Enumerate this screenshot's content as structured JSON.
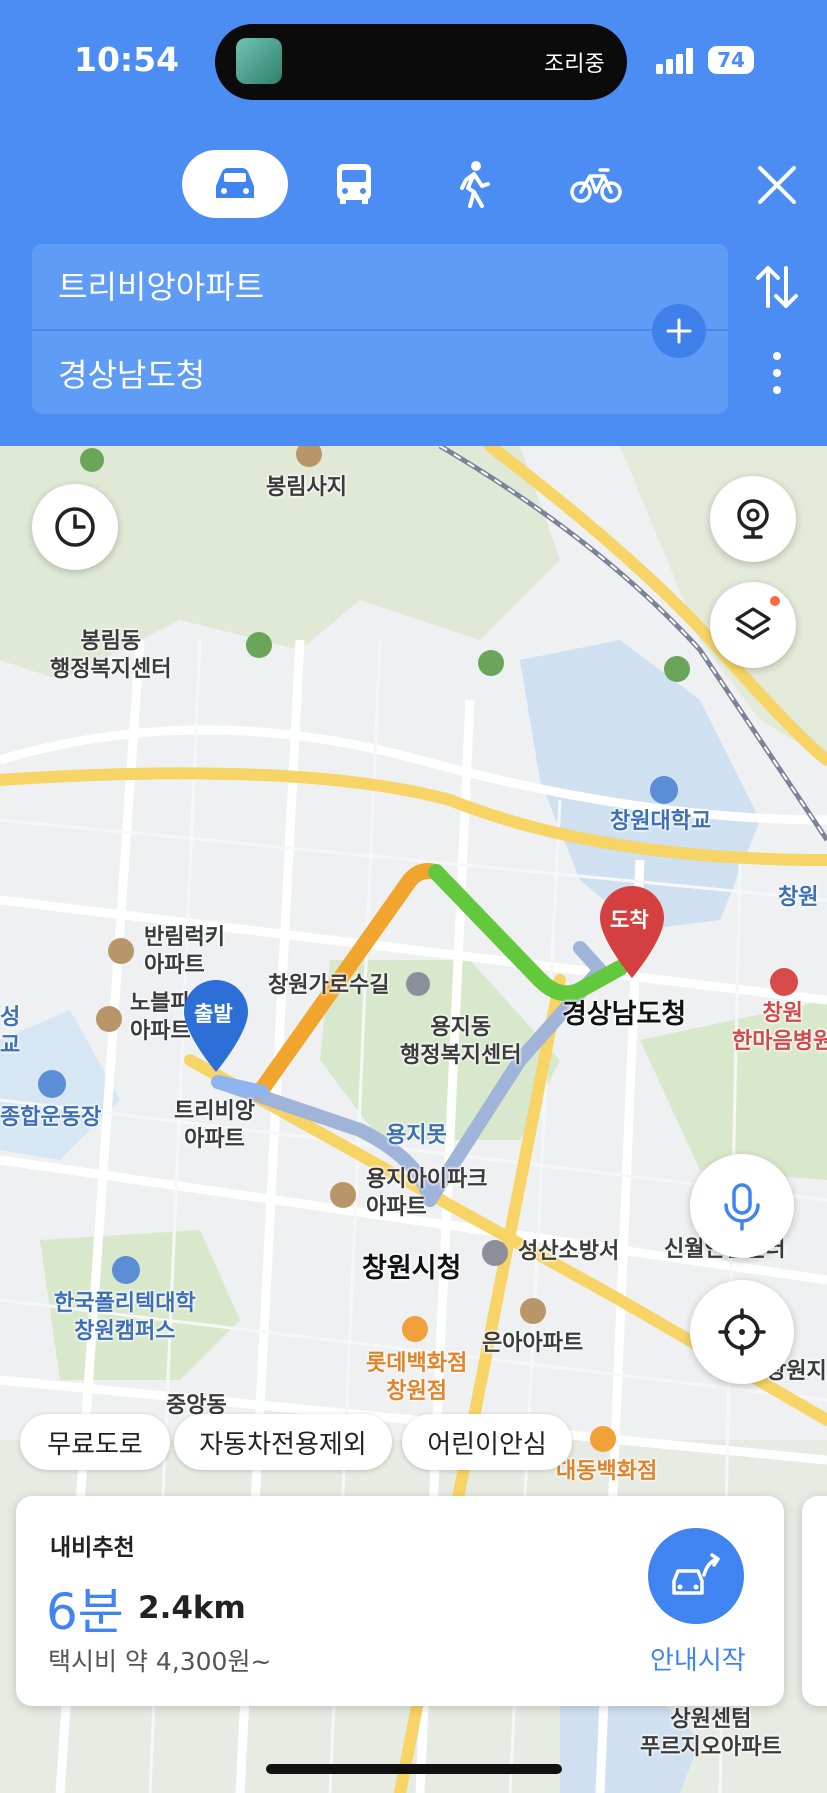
{
  "status_bar": {
    "time": "10:54",
    "activity": "조리중",
    "battery": "74"
  },
  "transport_modes": [
    {
      "id": "car",
      "icon": "car-icon",
      "selected": true
    },
    {
      "id": "bus",
      "icon": "bus-icon",
      "selected": false
    },
    {
      "id": "walk",
      "icon": "walk-icon",
      "selected": false
    },
    {
      "id": "bike",
      "icon": "bike-icon",
      "selected": false
    }
  ],
  "route": {
    "origin": "트리비앙아파트",
    "destination": "경상남도청"
  },
  "map": {
    "origin_pin": "출발",
    "destination_pin": "도착",
    "labels": {
      "bongrimsaji": "봉림사지",
      "bongrim_center": "봉림동\n행정복지센터",
      "university": "창원대학교",
      "changwon_edge": "창원",
      "banrim": "반림럭키\n아파트",
      "nobelpark": "노블파크\n아파트",
      "garosu": "창원가로수길",
      "yongji_center": "용지동\n행정복지센터",
      "gyeongnam": "경상남도청",
      "hospital": "창원\n한마음병원",
      "stadium": "종합운동장",
      "left_edge": "성\n교",
      "trivian": "트리비앙\n아파트",
      "yongjimot": "용지못",
      "ipark": "용지아이파크\n아파트",
      "cityhall": "창원시청",
      "firestation": "성산소방서",
      "sinwol": "신월안전센터",
      "polytech": "한국폴리텍대학\n창원캠퍼스",
      "euna": "은아아파트",
      "lotte": "롯데백화점\n창원점",
      "jungang": "중앙동",
      "daedong": "대동백화점",
      "right_edge": "창원지",
      "sangwon": "상원센텀\n푸르지오아파트"
    }
  },
  "filters": [
    "무료도로",
    "자동차전용제외",
    "어린이안심"
  ],
  "route_card": {
    "title": "내비추천",
    "time": "6분",
    "distance": "2.4km",
    "taxi_fare": "택시비 약 4,300원~",
    "start_label": "안내시작"
  },
  "colors": {
    "header": "#4c8df3",
    "accent": "#3f84f0",
    "route_green": "#62c93c",
    "route_orange": "#f1a52c"
  }
}
